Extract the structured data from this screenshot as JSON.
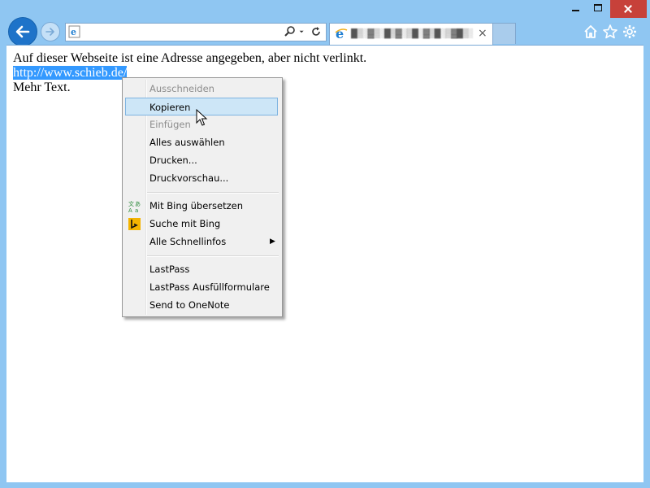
{
  "window": {
    "address_value": "",
    "tab_title": "█▒░▓▒░█▒▓░▒█░▓▒█░▒▓█▒░▓",
    "tab_close_glyph": "×"
  },
  "page": {
    "line1": "Auf dieser Webseite ist eine Adresse angegeben, aber nicht verlinkt.",
    "link_selected": "http://www.schieb.de/",
    "line3": "Mehr Text."
  },
  "context_menu": {
    "items": [
      {
        "label": "Ausschneiden",
        "enabled": false
      },
      {
        "label": "Kopieren",
        "enabled": true,
        "highlighted": true
      },
      {
        "label": "Einfügen",
        "enabled": false
      },
      {
        "label": "Alles auswählen",
        "enabled": true
      },
      {
        "label": "Drucken...",
        "enabled": true
      },
      {
        "label": "Druckvorschau...",
        "enabled": true
      },
      {
        "label": "Mit Bing übersetzen",
        "enabled": true,
        "icon": "translate-icon"
      },
      {
        "label": "Suche mit Bing",
        "enabled": true,
        "icon": "bing-icon"
      },
      {
        "label": "Alle Schnellinfos",
        "enabled": true,
        "submenu": true
      },
      {
        "label": "LastPass",
        "enabled": true
      },
      {
        "label": "LastPass Ausfüllformulare",
        "enabled": true
      },
      {
        "label": "Send to OneNote",
        "enabled": true
      }
    ]
  },
  "colors": {
    "frame": "#8fc6f2",
    "selection": "#3399ff",
    "close_button": "#c7413a",
    "menu_highlight": "#cde6f7"
  }
}
